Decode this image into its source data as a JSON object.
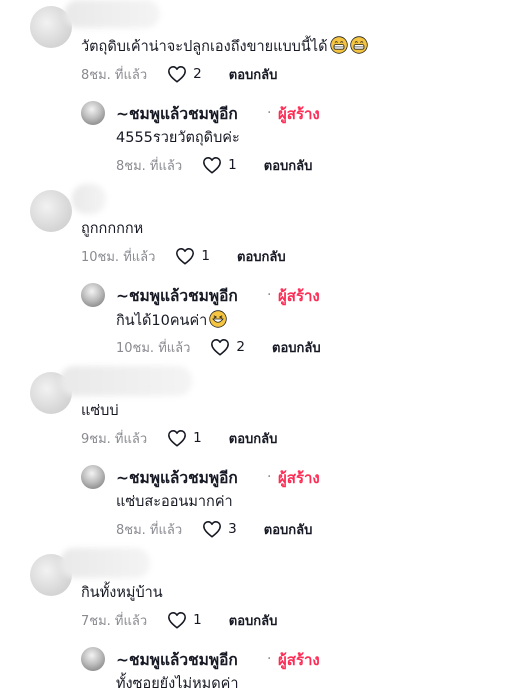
{
  "creator_name": "~ชมพูแล้วชมพูอีก",
  "creator_badge": "ผู้สร้าง",
  "separator": "·",
  "reply_label": "ตอบกลับ",
  "threads": [
    {
      "comment": {
        "text": "วัตถุดิบเค้าน่าจะปลูกเองถึงขายแบบนี้ได้",
        "time": "8ชม. ที่แล้ว",
        "likes": "2",
        "emoji": "grinning-face-icon x2"
      },
      "reply": {
        "text": "4555รวยวัตถุดิบค่ะ",
        "time": "8ชม. ที่แล้ว",
        "likes": "1"
      }
    },
    {
      "comment": {
        "text": "ถูกกกกกห",
        "time": "10ชม. ที่แล้ว",
        "likes": "1"
      },
      "reply": {
        "text": "กินได้10คนค่า",
        "time": "10ชม. ที่แล้ว",
        "likes": "2",
        "emoji": "laughing-face-icon"
      }
    },
    {
      "comment": {
        "text": "แซ่บบ่",
        "time": "9ชม. ที่แล้ว",
        "likes": "1"
      },
      "reply": {
        "text": "แซ่บสะออนมากค่า",
        "time": "8ชม. ที่แล้ว",
        "likes": "3"
      }
    },
    {
      "comment": {
        "text": "กินทั้งหมู่บ้าน",
        "time": "7ชม. ที่แล้ว",
        "likes": "1"
      },
      "reply": {
        "text": "ทั้งซอยยังไม่หมดค่า"
      }
    }
  ]
}
